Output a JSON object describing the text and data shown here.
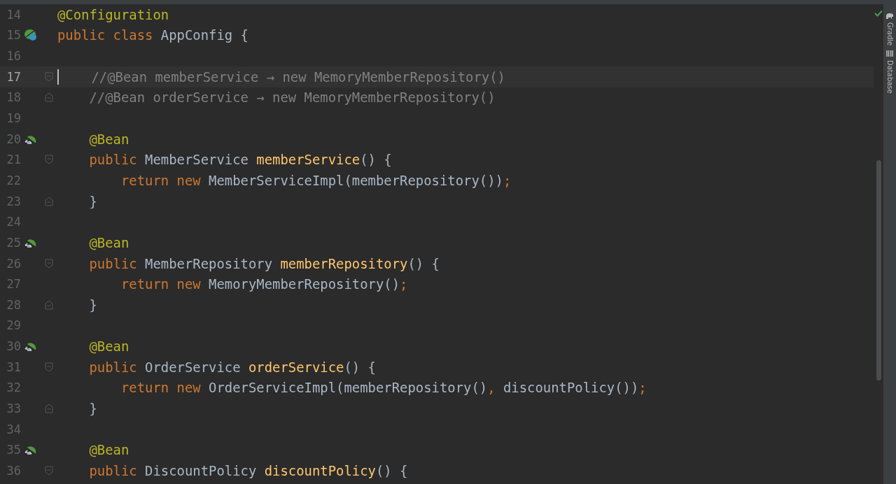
{
  "lines": [
    {
      "number": "14",
      "current": false,
      "tokens": [
        {
          "kind": "annotation",
          "text": "@Configuration"
        }
      ]
    },
    {
      "number": "15",
      "gutter_icon": {
        "kind": "config"
      },
      "current": false,
      "tokens": [
        {
          "kind": "keyword",
          "text": "public class "
        },
        {
          "kind": "plain",
          "text": "AppConfig {"
        }
      ]
    },
    {
      "number": "16",
      "current": false
    },
    {
      "number": "17",
      "fold_marker": {
        "kind": "open"
      },
      "current": true,
      "tokens": [
        {
          "kind": "comment",
          "text": "    //@Bean memberService → new MemoryMemberRepository()"
        }
      ]
    },
    {
      "number": "18",
      "fold_marker": {
        "kind": "close"
      },
      "current": false,
      "tokens": [
        {
          "kind": "comment",
          "text": "    //@Bean orderService → new MemoryMemberRepository()"
        }
      ]
    },
    {
      "number": "19",
      "current": false
    },
    {
      "number": "20",
      "gutter_icon": {
        "kind": "bean"
      },
      "current": false,
      "tokens": [
        {
          "kind": "annotation",
          "text": "    @Bean"
        }
      ]
    },
    {
      "number": "21",
      "fold_marker": {
        "kind": "open"
      },
      "current": false,
      "tokens": [
        {
          "kind": "keyword",
          "text": "    public "
        },
        {
          "kind": "plain",
          "text": "MemberService "
        },
        {
          "kind": "method",
          "text": "memberService"
        },
        {
          "kind": "plain",
          "text": "() {"
        }
      ]
    },
    {
      "number": "22",
      "current": false,
      "tokens": [
        {
          "kind": "keyword",
          "text": "        return new "
        },
        {
          "kind": "plain",
          "text": "MemberServiceImpl(memberRepository())"
        },
        {
          "kind": "keyword",
          "text": ";"
        }
      ]
    },
    {
      "number": "23",
      "fold_marker": {
        "kind": "close"
      },
      "current": false,
      "tokens": [
        {
          "kind": "plain",
          "text": "    }"
        }
      ]
    },
    {
      "number": "24",
      "current": false
    },
    {
      "number": "25",
      "gutter_icon": {
        "kind": "bean"
      },
      "current": false,
      "tokens": [
        {
          "kind": "annotation",
          "text": "    @Bean"
        }
      ]
    },
    {
      "number": "26",
      "fold_marker": {
        "kind": "open"
      },
      "current": false,
      "tokens": [
        {
          "kind": "keyword",
          "text": "    public "
        },
        {
          "kind": "plain",
          "text": "MemberRepository "
        },
        {
          "kind": "method",
          "text": "memberRepository"
        },
        {
          "kind": "plain",
          "text": "() {"
        }
      ]
    },
    {
      "number": "27",
      "current": false,
      "tokens": [
        {
          "kind": "keyword",
          "text": "        return new "
        },
        {
          "kind": "plain",
          "text": "MemoryMemberRepository()"
        },
        {
          "kind": "keyword",
          "text": ";"
        }
      ]
    },
    {
      "number": "28",
      "fold_marker": {
        "kind": "close"
      },
      "current": false,
      "tokens": [
        {
          "kind": "plain",
          "text": "    }"
        }
      ]
    },
    {
      "number": "29",
      "current": false
    },
    {
      "number": "30",
      "gutter_icon": {
        "kind": "bean"
      },
      "current": false,
      "tokens": [
        {
          "kind": "annotation",
          "text": "    @Bean"
        }
      ]
    },
    {
      "number": "31",
      "fold_marker": {
        "kind": "open"
      },
      "current": false,
      "tokens": [
        {
          "kind": "keyword",
          "text": "    public "
        },
        {
          "kind": "plain",
          "text": "OrderService "
        },
        {
          "kind": "method",
          "text": "orderService"
        },
        {
          "kind": "plain",
          "text": "() {"
        }
      ]
    },
    {
      "number": "32",
      "current": false,
      "tokens": [
        {
          "kind": "keyword",
          "text": "        return new "
        },
        {
          "kind": "plain",
          "text": "OrderServiceImpl(memberRepository()"
        },
        {
          "kind": "keyword",
          "text": ", "
        },
        {
          "kind": "plain",
          "text": "discountPolicy())"
        },
        {
          "kind": "keyword",
          "text": ";"
        }
      ]
    },
    {
      "number": "33",
      "fold_marker": {
        "kind": "close"
      },
      "current": false,
      "tokens": [
        {
          "kind": "plain",
          "text": "    }"
        }
      ]
    },
    {
      "number": "34",
      "current": false
    },
    {
      "number": "35",
      "gutter_icon": {
        "kind": "bean"
      },
      "current": false,
      "tokens": [
        {
          "kind": "annotation",
          "text": "    @Bean"
        }
      ]
    },
    {
      "number": "36",
      "fold_marker": {
        "kind": "open"
      },
      "current": false,
      "tokens": [
        {
          "kind": "keyword",
          "text": "    public "
        },
        {
          "kind": "plain",
          "text": "DiscountPolicy "
        },
        {
          "kind": "method",
          "text": "discountPolicy"
        },
        {
          "kind": "plain",
          "text": "() {"
        }
      ]
    }
  ],
  "tool_windows": [
    {
      "label": "Gradle",
      "kind": "gradle"
    },
    {
      "label": "Database",
      "kind": "database"
    }
  ]
}
